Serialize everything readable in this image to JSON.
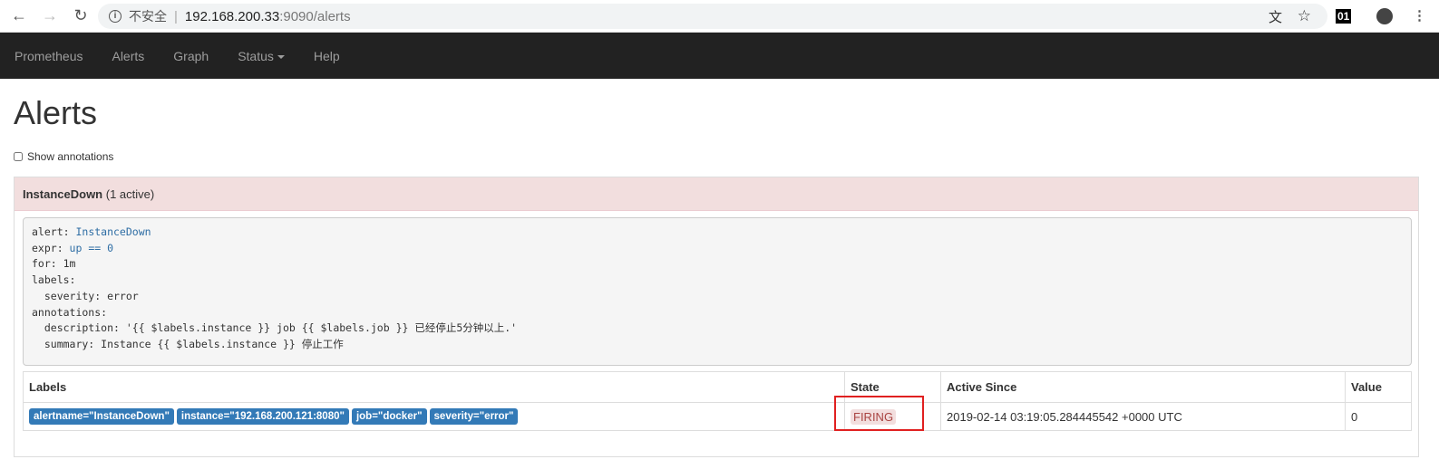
{
  "browser": {
    "security": "不安全",
    "url_host": "192.168.200.33",
    "url_rest": ":9090/alerts",
    "ext_label": "01"
  },
  "nav": {
    "brand": "Prometheus",
    "items": [
      "Alerts",
      "Graph",
      "Status",
      "Help"
    ]
  },
  "page": {
    "title": "Alerts",
    "show_annotations": "Show annotations",
    "show_annotations_checked": false
  },
  "group": {
    "name": "InstanceDown",
    "count": "(1 active)",
    "rule": [
      {
        "k": "alert: ",
        "v": "InstanceDown"
      },
      {
        "k": "expr: ",
        "v": "up == 0"
      },
      {
        "k": "for: 1m",
        "v": ""
      },
      {
        "k": "labels:",
        "v": ""
      },
      {
        "k": "  severity: error",
        "v": ""
      },
      {
        "k": "annotations:",
        "v": ""
      },
      {
        "k": "  description: '{{ $labels.instance }} job {{ $labels.job }} 已经停止5分钟以上.'",
        "v": ""
      },
      {
        "k": "  summary: Instance {{ $labels.instance }} 停止工作",
        "v": ""
      }
    ]
  },
  "table": {
    "headers": [
      "Labels",
      "State",
      "Active Since",
      "Value"
    ],
    "rows": [
      {
        "labels": [
          "alertname=\"InstanceDown\"",
          "instance=\"192.168.200.121:8080\"",
          "job=\"docker\"",
          "severity=\"error\""
        ],
        "state": "FIRING",
        "active_since": "2019-02-14 03:19:05.284445542 +0000 UTC",
        "value": "0"
      }
    ]
  },
  "colors": {
    "navbar": "#222222",
    "firing_bg": "#f2dede",
    "label_bg": "#337ab7",
    "highlight": "#e02020"
  }
}
